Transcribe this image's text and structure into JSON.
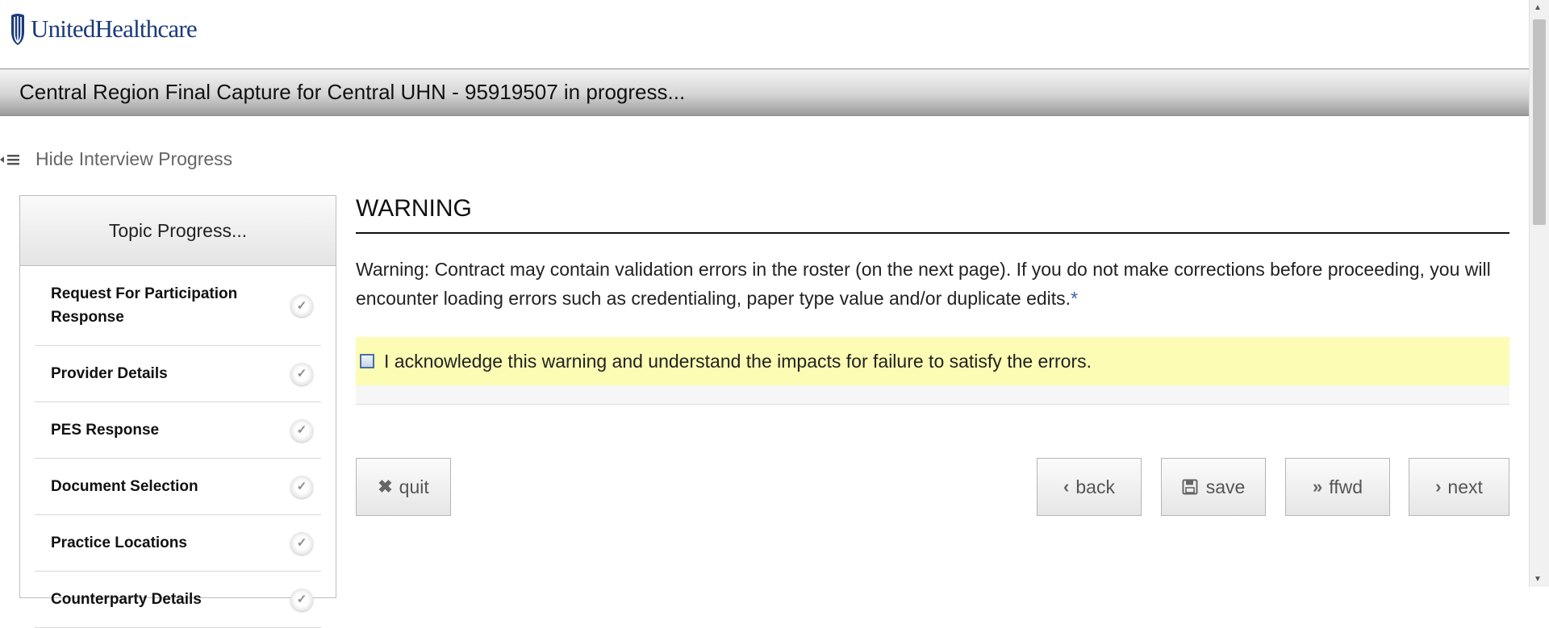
{
  "header": {
    "logo_text": "UnitedHealthcare"
  },
  "titlebar": {
    "title": "Central Region Final Capture for Central UHN - 95919507 in progress..."
  },
  "progress_toggle": {
    "label": "Hide Interview Progress"
  },
  "sidebar": {
    "heading": "Topic Progress...",
    "topics": [
      {
        "label": "Request For Participation Response"
      },
      {
        "label": "Provider Details"
      },
      {
        "label": "PES Response"
      },
      {
        "label": "Document Selection"
      },
      {
        "label": "Practice Locations"
      },
      {
        "label": "Counterparty Details"
      }
    ]
  },
  "main": {
    "heading": "WARNING",
    "warning_text": "Warning: Contract may contain validation errors in the roster (on the next page). If you do not make corrections before proceeding, you will encounter loading errors such as credentialing, paper type value and/or duplicate edits.",
    "required_mark": "*",
    "acknowledge_label": "I acknowledge this warning and understand the impacts for failure to satisfy the errors.",
    "acknowledge_checked": false
  },
  "buttons": {
    "quit": "quit",
    "back": "back",
    "save": "save",
    "ffwd": "ffwd",
    "next": "next"
  },
  "colors": {
    "brand": "#1c3b7a",
    "ack_highlight": "#fcfcb4"
  }
}
